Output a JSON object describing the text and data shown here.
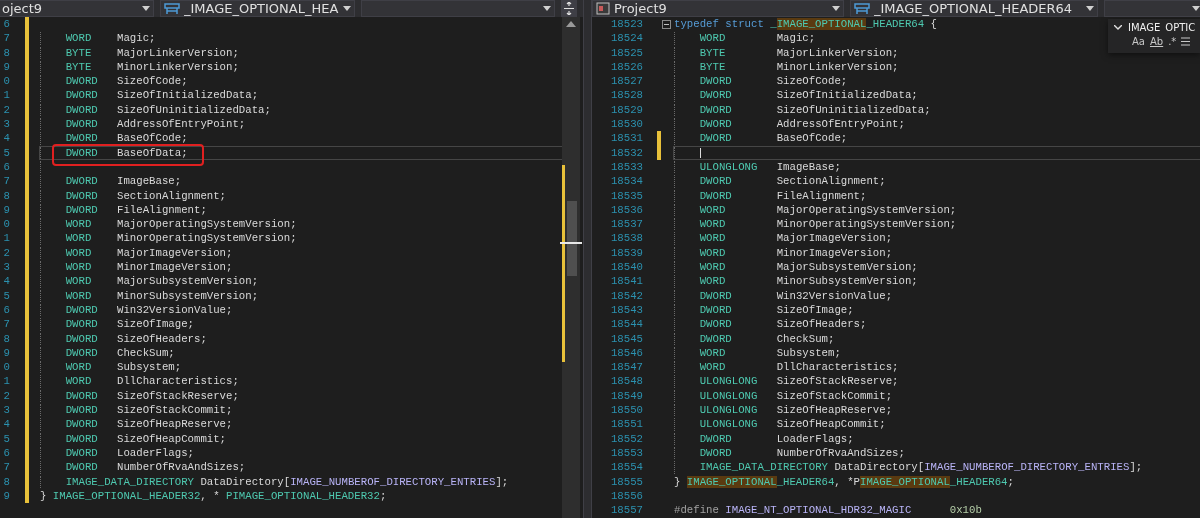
{
  "left_pane": {
    "dropdowns": [
      {
        "label": "oject9",
        "kind": "text"
      },
      {
        "label": "_IMAGE_OPTIONAL_HEA",
        "kind": "struct"
      }
    ],
    "lines": [
      {
        "number": "6",
        "changed": true,
        "current": false,
        "annotated": false,
        "indented": false
      },
      {
        "number": "7",
        "changed": true,
        "current": false,
        "annotated": false,
        "indented": true,
        "tokens": [
          {
            "text": "WORD    ",
            "kind": "type"
          },
          {
            "text": "Magic;",
            "kind": "plain"
          }
        ]
      },
      {
        "number": "8",
        "changed": true,
        "current": false,
        "annotated": false,
        "indented": true,
        "tokens": [
          {
            "text": "BYTE    ",
            "kind": "type"
          },
          {
            "text": "MajorLinkerVersion;",
            "kind": "plain"
          }
        ]
      },
      {
        "number": "9",
        "changed": true,
        "current": false,
        "annotated": false,
        "indented": true,
        "tokens": [
          {
            "text": "BYTE    ",
            "kind": "type"
          },
          {
            "text": "MinorLinkerVersion;",
            "kind": "plain"
          }
        ]
      },
      {
        "number": "0",
        "changed": true,
        "current": false,
        "annotated": false,
        "indented": true,
        "tokens": [
          {
            "text": "DWORD   ",
            "kind": "type"
          },
          {
            "text": "SizeOfCode;",
            "kind": "plain"
          }
        ]
      },
      {
        "number": "1",
        "changed": true,
        "current": false,
        "annotated": false,
        "indented": true,
        "tokens": [
          {
            "text": "DWORD   ",
            "kind": "type"
          },
          {
            "text": "SizeOfInitializedData;",
            "kind": "plain"
          }
        ]
      },
      {
        "number": "2",
        "changed": true,
        "current": false,
        "annotated": false,
        "indented": true,
        "tokens": [
          {
            "text": "DWORD   ",
            "kind": "type"
          },
          {
            "text": "SizeOfUninitializedData;",
            "kind": "plain"
          }
        ]
      },
      {
        "number": "3",
        "changed": true,
        "current": false,
        "annotated": false,
        "indented": true,
        "tokens": [
          {
            "text": "DWORD   ",
            "kind": "type"
          },
          {
            "text": "AddressOfEntryPoint;",
            "kind": "plain"
          }
        ]
      },
      {
        "number": "4",
        "changed": true,
        "current": false,
        "annotated": false,
        "indented": true,
        "tokens": [
          {
            "text": "DWORD   ",
            "kind": "type"
          },
          {
            "text": "BaseOfCode;",
            "kind": "plain"
          }
        ]
      },
      {
        "number": "5",
        "changed": true,
        "current": true,
        "annotated": true,
        "indented": true,
        "tokens": [
          {
            "text": "DWORD   ",
            "kind": "type"
          },
          {
            "text": "BaseOfData;",
            "kind": "plain"
          }
        ]
      },
      {
        "number": "6",
        "changed": true,
        "current": false,
        "annotated": false,
        "indented": true
      },
      {
        "number": "7",
        "changed": true,
        "current": false,
        "annotated": false,
        "indented": true,
        "tokens": [
          {
            "text": "DWORD   ",
            "kind": "type"
          },
          {
            "text": "ImageBase;",
            "kind": "plain"
          }
        ]
      },
      {
        "number": "8",
        "changed": true,
        "current": false,
        "annotated": false,
        "indented": true,
        "tokens": [
          {
            "text": "DWORD   ",
            "kind": "type"
          },
          {
            "text": "SectionAlignment;",
            "kind": "plain"
          }
        ]
      },
      {
        "number": "9",
        "changed": true,
        "current": false,
        "annotated": false,
        "indented": true,
        "tokens": [
          {
            "text": "DWORD   ",
            "kind": "type"
          },
          {
            "text": "FileAlignment;",
            "kind": "plain"
          }
        ]
      },
      {
        "number": "0",
        "changed": true,
        "current": false,
        "annotated": false,
        "indented": true,
        "tokens": [
          {
            "text": "WORD    ",
            "kind": "type"
          },
          {
            "text": "MajorOperatingSystemVersion;",
            "kind": "plain"
          }
        ]
      },
      {
        "number": "1",
        "changed": true,
        "current": false,
        "annotated": false,
        "indented": true,
        "tokens": [
          {
            "text": "WORD    ",
            "kind": "type"
          },
          {
            "text": "MinorOperatingSystemVersion;",
            "kind": "plain"
          }
        ]
      },
      {
        "number": "2",
        "changed": true,
        "current": false,
        "annotated": false,
        "indented": true,
        "tokens": [
          {
            "text": "WORD    ",
            "kind": "type"
          },
          {
            "text": "MajorImageVersion;",
            "kind": "plain"
          }
        ]
      },
      {
        "number": "3",
        "changed": true,
        "current": false,
        "annotated": false,
        "indented": true,
        "tokens": [
          {
            "text": "WORD    ",
            "kind": "type"
          },
          {
            "text": "MinorImageVersion;",
            "kind": "plain"
          }
        ]
      },
      {
        "number": "4",
        "changed": true,
        "current": false,
        "annotated": false,
        "indented": true,
        "tokens": [
          {
            "text": "WORD    ",
            "kind": "type"
          },
          {
            "text": "MajorSubsystemVersion;",
            "kind": "plain"
          }
        ]
      },
      {
        "number": "5",
        "changed": true,
        "current": false,
        "annotated": false,
        "indented": true,
        "tokens": [
          {
            "text": "WORD    ",
            "kind": "type"
          },
          {
            "text": "MinorSubsystemVersion;",
            "kind": "plain"
          }
        ]
      },
      {
        "number": "6",
        "changed": true,
        "current": false,
        "annotated": false,
        "indented": true,
        "tokens": [
          {
            "text": "DWORD   ",
            "kind": "type"
          },
          {
            "text": "Win32VersionValue;",
            "kind": "plain"
          }
        ]
      },
      {
        "number": "7",
        "changed": true,
        "current": false,
        "annotated": false,
        "indented": true,
        "tokens": [
          {
            "text": "DWORD   ",
            "kind": "type"
          },
          {
            "text": "SizeOfImage;",
            "kind": "plain"
          }
        ]
      },
      {
        "number": "8",
        "changed": true,
        "current": false,
        "annotated": false,
        "indented": true,
        "tokens": [
          {
            "text": "DWORD   ",
            "kind": "type"
          },
          {
            "text": "SizeOfHeaders;",
            "kind": "plain"
          }
        ]
      },
      {
        "number": "9",
        "changed": true,
        "current": false,
        "annotated": false,
        "indented": true,
        "tokens": [
          {
            "text": "DWORD   ",
            "kind": "type"
          },
          {
            "text": "CheckSum;",
            "kind": "plain"
          }
        ]
      },
      {
        "number": "0",
        "changed": true,
        "current": false,
        "annotated": false,
        "indented": true,
        "tokens": [
          {
            "text": "WORD    ",
            "kind": "type"
          },
          {
            "text": "Subsystem;",
            "kind": "plain"
          }
        ]
      },
      {
        "number": "1",
        "changed": true,
        "current": false,
        "annotated": false,
        "indented": true,
        "tokens": [
          {
            "text": "WORD    ",
            "kind": "type"
          },
          {
            "text": "DllCharacteristics;",
            "kind": "plain"
          }
        ]
      },
      {
        "number": "2",
        "changed": true,
        "current": false,
        "annotated": false,
        "indented": true,
        "tokens": [
          {
            "text": "DWORD   ",
            "kind": "type"
          },
          {
            "text": "SizeOfStackReserve;",
            "kind": "plain"
          }
        ]
      },
      {
        "number": "3",
        "changed": true,
        "current": false,
        "annotated": false,
        "indented": true,
        "tokens": [
          {
            "text": "DWORD   ",
            "kind": "type"
          },
          {
            "text": "SizeOfStackCommit;",
            "kind": "plain"
          }
        ]
      },
      {
        "number": "4",
        "changed": true,
        "current": false,
        "annotated": false,
        "indented": true,
        "tokens": [
          {
            "text": "DWORD   ",
            "kind": "type"
          },
          {
            "text": "SizeOfHeapReserve;",
            "kind": "plain"
          }
        ]
      },
      {
        "number": "5",
        "changed": true,
        "current": false,
        "annotated": false,
        "indented": true,
        "tokens": [
          {
            "text": "DWORD   ",
            "kind": "type"
          },
          {
            "text": "SizeOfHeapCommit;",
            "kind": "plain"
          }
        ]
      },
      {
        "number": "6",
        "changed": true,
        "current": false,
        "annotated": false,
        "indented": true,
        "tokens": [
          {
            "text": "DWORD   ",
            "kind": "type"
          },
          {
            "text": "LoaderFlags;",
            "kind": "plain"
          }
        ]
      },
      {
        "number": "7",
        "changed": true,
        "current": false,
        "annotated": false,
        "indented": true,
        "tokens": [
          {
            "text": "DWORD   ",
            "kind": "type"
          },
          {
            "text": "NumberOfRvaAndSizes;",
            "kind": "plain"
          }
        ]
      },
      {
        "number": "8",
        "changed": true,
        "current": false,
        "annotated": false,
        "indented": true,
        "tokens": [
          {
            "text": "IMAGE_DATA_DIRECTORY ",
            "kind": "type"
          },
          {
            "text": "DataDirectory[",
            "kind": "plain"
          },
          {
            "text": "IMAGE_NUMBEROF_DIRECTORY_ENTRIES",
            "kind": "macro"
          },
          {
            "text": "];",
            "kind": "plain"
          }
        ]
      },
      {
        "number": "9",
        "changed": true,
        "current": false,
        "annotated": false,
        "indented": false,
        "tokens": [
          {
            "text": "} ",
            "kind": "plain"
          },
          {
            "text": "IMAGE_OPTIONAL_HEADER32",
            "kind": "type"
          },
          {
            "text": ", * ",
            "kind": "plain"
          },
          {
            "text": "PIMAGE_OPTIONAL_HEADER32",
            "kind": "type"
          },
          {
            "text": ";",
            "kind": "plain"
          }
        ]
      }
    ]
  },
  "right_pane": {
    "dropdowns": [
      {
        "label": "Project9",
        "kind": "project"
      },
      {
        "label": "_IMAGE_OPTIONAL_HEADER64",
        "kind": "struct"
      }
    ],
    "find_box": {
      "value": "IMAGE_OPTIC",
      "options": [
        "Aa",
        "Ab",
        ".*"
      ]
    },
    "lines": [
      {
        "number": "18523",
        "changed": false,
        "current": false,
        "indented": false,
        "fold": true,
        "tokens": [
          {
            "text": "typedef struct ",
            "kind": "keyword"
          },
          {
            "text": "_",
            "kind": "type"
          },
          {
            "text": "IMAGE_OPTIONAL",
            "kind": "type-match"
          },
          {
            "text": "_HEADER64",
            "kind": "type"
          },
          {
            "text": " {",
            "kind": "plain"
          }
        ]
      },
      {
        "number": "18524",
        "changed": false,
        "current": false,
        "indented": true,
        "tokens": [
          {
            "text": "WORD        ",
            "kind": "type"
          },
          {
            "text": "Magic;",
            "kind": "plain"
          }
        ]
      },
      {
        "number": "18525",
        "changed": false,
        "current": false,
        "indented": true,
        "tokens": [
          {
            "text": "BYTE        ",
            "kind": "type"
          },
          {
            "text": "MajorLinkerVersion;",
            "kind": "plain"
          }
        ]
      },
      {
        "number": "18526",
        "changed": false,
        "current": false,
        "indented": true,
        "tokens": [
          {
            "text": "BYTE        ",
            "kind": "type"
          },
          {
            "text": "MinorLinkerVersion;",
            "kind": "plain"
          }
        ]
      },
      {
        "number": "18527",
        "changed": false,
        "current": false,
        "indented": true,
        "tokens": [
          {
            "text": "DWORD       ",
            "kind": "type"
          },
          {
            "text": "SizeOfCode;",
            "kind": "plain"
          }
        ]
      },
      {
        "number": "18528",
        "changed": false,
        "current": false,
        "indented": true,
        "tokens": [
          {
            "text": "DWORD       ",
            "kind": "type"
          },
          {
            "text": "SizeOfInitializedData;",
            "kind": "plain"
          }
        ]
      },
      {
        "number": "18529",
        "changed": false,
        "current": false,
        "indented": true,
        "tokens": [
          {
            "text": "DWORD       ",
            "kind": "type"
          },
          {
            "text": "SizeOfUninitializedData;",
            "kind": "plain"
          }
        ]
      },
      {
        "number": "18530",
        "changed": false,
        "current": false,
        "indented": true,
        "tokens": [
          {
            "text": "DWORD       ",
            "kind": "type"
          },
          {
            "text": "AddressOfEntryPoint;",
            "kind": "plain"
          }
        ]
      },
      {
        "number": "18531",
        "changed": true,
        "current": false,
        "indented": true,
        "tokens": [
          {
            "text": "DWORD       ",
            "kind": "type"
          },
          {
            "text": "BaseOfCode;",
            "kind": "plain"
          }
        ]
      },
      {
        "number": "18532",
        "changed": true,
        "current": true,
        "indented": true
      },
      {
        "number": "18533",
        "changed": false,
        "current": false,
        "indented": true,
        "tokens": [
          {
            "text": "ULONGLONG   ",
            "kind": "type"
          },
          {
            "text": "ImageBase;",
            "kind": "plain"
          }
        ]
      },
      {
        "number": "18534",
        "changed": false,
        "current": false,
        "indented": true,
        "tokens": [
          {
            "text": "DWORD       ",
            "kind": "type"
          },
          {
            "text": "SectionAlignment;",
            "kind": "plain"
          }
        ]
      },
      {
        "number": "18535",
        "changed": false,
        "current": false,
        "indented": true,
        "tokens": [
          {
            "text": "DWORD       ",
            "kind": "type"
          },
          {
            "text": "FileAlignment;",
            "kind": "plain"
          }
        ]
      },
      {
        "number": "18536",
        "changed": false,
        "current": false,
        "indented": true,
        "tokens": [
          {
            "text": "WORD        ",
            "kind": "type"
          },
          {
            "text": "MajorOperatingSystemVersion;",
            "kind": "plain"
          }
        ]
      },
      {
        "number": "18537",
        "changed": false,
        "current": false,
        "indented": true,
        "tokens": [
          {
            "text": "WORD        ",
            "kind": "type"
          },
          {
            "text": "MinorOperatingSystemVersion;",
            "kind": "plain"
          }
        ]
      },
      {
        "number": "18538",
        "changed": false,
        "current": false,
        "indented": true,
        "tokens": [
          {
            "text": "WORD        ",
            "kind": "type"
          },
          {
            "text": "MajorImageVersion;",
            "kind": "plain"
          }
        ]
      },
      {
        "number": "18539",
        "changed": false,
        "current": false,
        "indented": true,
        "tokens": [
          {
            "text": "WORD        ",
            "kind": "type"
          },
          {
            "text": "MinorImageVersion;",
            "kind": "plain"
          }
        ]
      },
      {
        "number": "18540",
        "changed": false,
        "current": false,
        "indented": true,
        "tokens": [
          {
            "text": "WORD        ",
            "kind": "type"
          },
          {
            "text": "MajorSubsystemVersion;",
            "kind": "plain"
          }
        ]
      },
      {
        "number": "18541",
        "changed": false,
        "current": false,
        "indented": true,
        "tokens": [
          {
            "text": "WORD        ",
            "kind": "type"
          },
          {
            "text": "MinorSubsystemVersion;",
            "kind": "plain"
          }
        ]
      },
      {
        "number": "18542",
        "changed": false,
        "current": false,
        "indented": true,
        "tokens": [
          {
            "text": "DWORD       ",
            "kind": "type"
          },
          {
            "text": "Win32VersionValue;",
            "kind": "plain"
          }
        ]
      },
      {
        "number": "18543",
        "changed": false,
        "current": false,
        "indented": true,
        "tokens": [
          {
            "text": "DWORD       ",
            "kind": "type"
          },
          {
            "text": "SizeOfImage;",
            "kind": "plain"
          }
        ]
      },
      {
        "number": "18544",
        "changed": false,
        "current": false,
        "indented": true,
        "tokens": [
          {
            "text": "DWORD       ",
            "kind": "type"
          },
          {
            "text": "SizeOfHeaders;",
            "kind": "plain"
          }
        ]
      },
      {
        "number": "18545",
        "changed": false,
        "current": false,
        "indented": true,
        "tokens": [
          {
            "text": "DWORD       ",
            "kind": "type"
          },
          {
            "text": "CheckSum;",
            "kind": "plain"
          }
        ]
      },
      {
        "number": "18546",
        "changed": false,
        "current": false,
        "indented": true,
        "tokens": [
          {
            "text": "WORD        ",
            "kind": "type"
          },
          {
            "text": "Subsystem;",
            "kind": "plain"
          }
        ]
      },
      {
        "number": "18547",
        "changed": false,
        "current": false,
        "indented": true,
        "tokens": [
          {
            "text": "WORD        ",
            "kind": "type"
          },
          {
            "text": "DllCharacteristics;",
            "kind": "plain"
          }
        ]
      },
      {
        "number": "18548",
        "changed": false,
        "current": false,
        "indented": true,
        "tokens": [
          {
            "text": "ULONGLONG   ",
            "kind": "type"
          },
          {
            "text": "SizeOfStackReserve;",
            "kind": "plain"
          }
        ]
      },
      {
        "number": "18549",
        "changed": false,
        "current": false,
        "indented": true,
        "tokens": [
          {
            "text": "ULONGLONG   ",
            "kind": "type"
          },
          {
            "text": "SizeOfStackCommit;",
            "kind": "plain"
          }
        ]
      },
      {
        "number": "18550",
        "changed": false,
        "current": false,
        "indented": true,
        "tokens": [
          {
            "text": "ULONGLONG   ",
            "kind": "type"
          },
          {
            "text": "SizeOfHeapReserve;",
            "kind": "plain"
          }
        ]
      },
      {
        "number": "18551",
        "changed": false,
        "current": false,
        "indented": true,
        "tokens": [
          {
            "text": "ULONGLONG   ",
            "kind": "type"
          },
          {
            "text": "SizeOfHeapCommit;",
            "kind": "plain"
          }
        ]
      },
      {
        "number": "18552",
        "changed": false,
        "current": false,
        "indented": true,
        "tokens": [
          {
            "text": "DWORD       ",
            "kind": "type"
          },
          {
            "text": "LoaderFlags;",
            "kind": "plain"
          }
        ]
      },
      {
        "number": "18553",
        "changed": false,
        "current": false,
        "indented": true,
        "tokens": [
          {
            "text": "DWORD       ",
            "kind": "type"
          },
          {
            "text": "NumberOfRvaAndSizes;",
            "kind": "plain"
          }
        ]
      },
      {
        "number": "18554",
        "changed": false,
        "current": false,
        "indented": true,
        "tokens": [
          {
            "text": "IMAGE_DATA_DIRECTORY ",
            "kind": "type"
          },
          {
            "text": "DataDirectory[",
            "kind": "plain"
          },
          {
            "text": "IMAGE_NUMBEROF_DIRECTORY_ENTRIES",
            "kind": "macro"
          },
          {
            "text": "];",
            "kind": "plain"
          }
        ]
      },
      {
        "number": "18555",
        "changed": false,
        "current": false,
        "indented": false,
        "tokens": [
          {
            "text": "} ",
            "kind": "plain"
          },
          {
            "text": "IMAGE_OPTIONAL",
            "kind": "type-match"
          },
          {
            "text": "_HEADER64",
            "kind": "type"
          },
          {
            "text": ", *P",
            "kind": "plain"
          },
          {
            "text": "IMAGE_OPTIONAL",
            "kind": "type-match"
          },
          {
            "text": "_HEADER64",
            "kind": "type"
          },
          {
            "text": ";",
            "kind": "plain"
          }
        ]
      },
      {
        "number": "18556",
        "changed": false,
        "current": false,
        "indented": false
      },
      {
        "number": "18557",
        "changed": false,
        "current": false,
        "indented": false,
        "tokens": [
          {
            "text": "#define ",
            "kind": "preproc"
          },
          {
            "text": "IMAGE_NT_OPTIONAL_HDR32_MAGIC",
            "kind": "macro"
          },
          {
            "text": "      0x10b",
            "kind": "number"
          }
        ]
      }
    ]
  }
}
